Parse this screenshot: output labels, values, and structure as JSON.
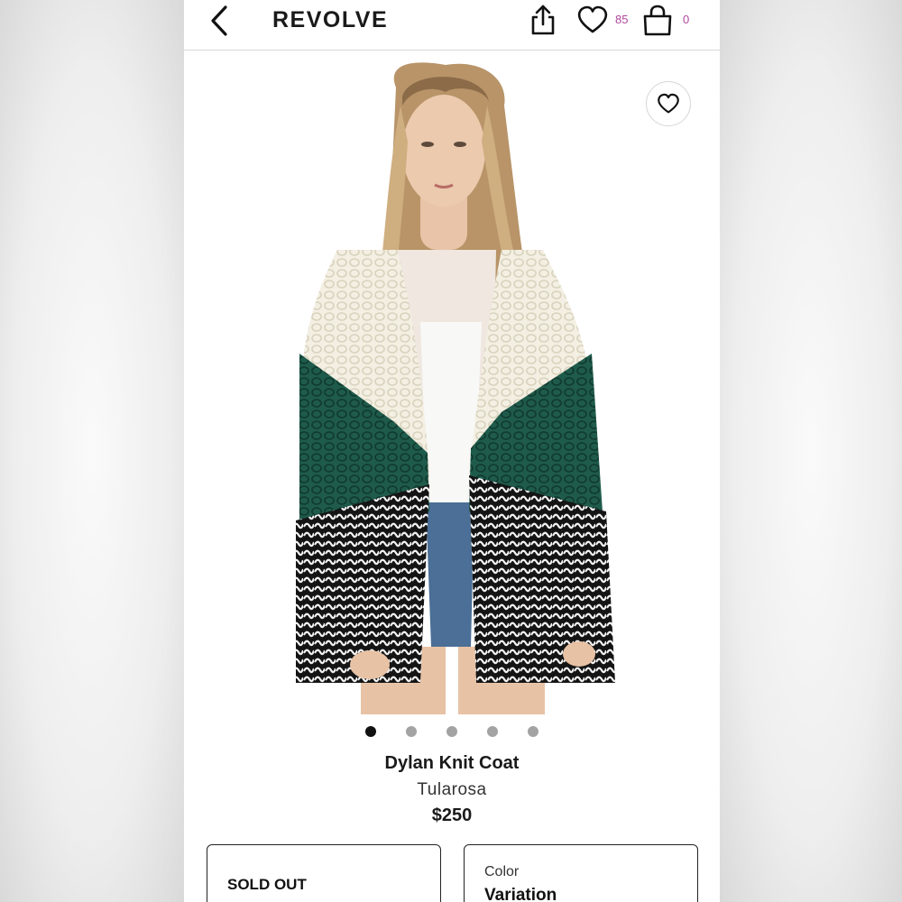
{
  "header": {
    "logo": "REVOLVE",
    "wishlist_count": "85",
    "bag_count": "0"
  },
  "product": {
    "name": "Dylan Knit Coat",
    "brand": "Tularosa",
    "price": "$250",
    "image_count": 5,
    "active_image_index": 0
  },
  "size_selector": {
    "status": "SOLD OUT"
  },
  "color_selector": {
    "label": "Color",
    "value": "Variation"
  },
  "colors": {
    "accent": "#b0479c",
    "text": "#1a1a1a"
  }
}
